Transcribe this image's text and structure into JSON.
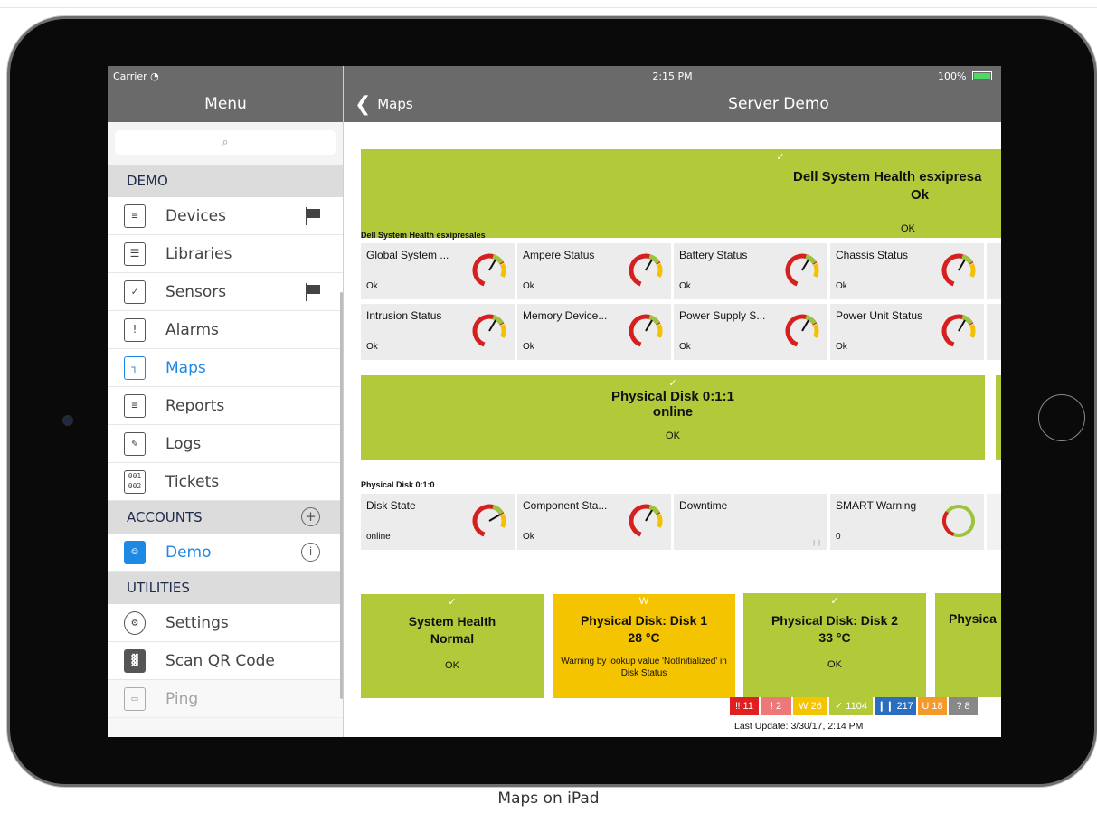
{
  "caption": "Maps on iPad",
  "status": {
    "carrier": "Carrier",
    "time": "2:15 PM",
    "battery": "100%"
  },
  "sidebar": {
    "title": "Menu",
    "search_placeholder": "⌕",
    "sections": {
      "demo": "DEMO",
      "accounts": "ACCOUNTS",
      "utilities": "UTILITIES"
    },
    "items": [
      {
        "label": "Devices",
        "icon": "devices-icon",
        "flag": true
      },
      {
        "label": "Libraries",
        "icon": "libraries-icon",
        "flag": false
      },
      {
        "label": "Sensors",
        "icon": "sensors-icon",
        "flag": true
      },
      {
        "label": "Alarms",
        "icon": "alarms-icon",
        "flag": false
      },
      {
        "label": "Maps",
        "icon": "maps-icon",
        "flag": false,
        "active": true
      },
      {
        "label": "Reports",
        "icon": "reports-icon",
        "flag": false
      },
      {
        "label": "Logs",
        "icon": "logs-icon",
        "flag": false
      },
      {
        "label": "Tickets",
        "icon": "tickets-icon",
        "flag": false
      }
    ],
    "account": {
      "label": "Demo"
    },
    "utilities": [
      {
        "label": "Settings",
        "icon": "gear-icon"
      },
      {
        "label": "Scan QR Code",
        "icon": "qr-code-icon"
      },
      {
        "label": "Ping",
        "icon": "ping-icon"
      }
    ]
  },
  "main": {
    "back_label": "Maps",
    "title": "Server Demo",
    "banner1": {
      "check": "✓",
      "title_line1": "Dell System Health esxipresa",
      "title_line2": "Ok",
      "ok": "OK"
    },
    "group1_label": "Dell System Health esxipresales",
    "group1_tiles": [
      {
        "name": "Global System ...",
        "value": "Ok"
      },
      {
        "name": "Ampere Status",
        "value": "Ok"
      },
      {
        "name": "Battery Status",
        "value": "Ok"
      },
      {
        "name": "Chassis Status",
        "value": "Ok"
      },
      {
        "name": "Intrusion Status",
        "value": "Ok"
      },
      {
        "name": "Memory Device...",
        "value": "Ok"
      },
      {
        "name": "Power Supply S...",
        "value": "Ok"
      },
      {
        "name": "Power Unit Status",
        "value": "Ok"
      }
    ],
    "banner2": {
      "check": "✓",
      "title_line1": "Physical Disk 0:1:1",
      "title_line2": "online",
      "ok": "OK"
    },
    "group2_label": "Physical Disk 0:1:0",
    "group2_tiles": [
      {
        "name": "Disk State",
        "value": "online"
      },
      {
        "name": "Component Sta...",
        "value": "Ok"
      },
      {
        "name": "Downtime",
        "value": ""
      },
      {
        "name": "SMART Warning",
        "value": "0"
      }
    ],
    "cards": [
      {
        "mark": "✓",
        "line1": "System Health",
        "line2": "Normal",
        "status": "OK",
        "state": "ok"
      },
      {
        "mark": "W",
        "line1": "Physical Disk: Disk 1",
        "line2": "28 °C",
        "status": "Warning by lookup value 'NotInitialized' in Disk Status",
        "state": "warning"
      },
      {
        "mark": "✓",
        "line1": "Physical Disk: Disk 2",
        "line2": "33 °C",
        "status": "OK",
        "state": "ok"
      },
      {
        "mark": "",
        "line1": "Physica",
        "line2": "",
        "status": "",
        "state": "ok"
      }
    ],
    "legend": [
      {
        "text": "‼ 11",
        "color": "#e02020"
      },
      {
        "text": "! 2",
        "color": "#ee7777"
      },
      {
        "text": "W 26",
        "color": "#f5c400"
      },
      {
        "text": "✓ 1104",
        "color": "#b2c93a"
      },
      {
        "text": "❙❙ 217",
        "color": "#2a6ebf"
      },
      {
        "text": "U 18",
        "color": "#f39a2a"
      },
      {
        "text": "? 8",
        "color": "#888888"
      }
    ],
    "last_update": "Last Update: 3/30/17, 2:14 PM"
  },
  "colors": {
    "ok_green": "#b2c93a",
    "warning_yellow": "#f5c400",
    "header_gray": "#6a6a6a",
    "active_blue": "#1e88e5"
  }
}
